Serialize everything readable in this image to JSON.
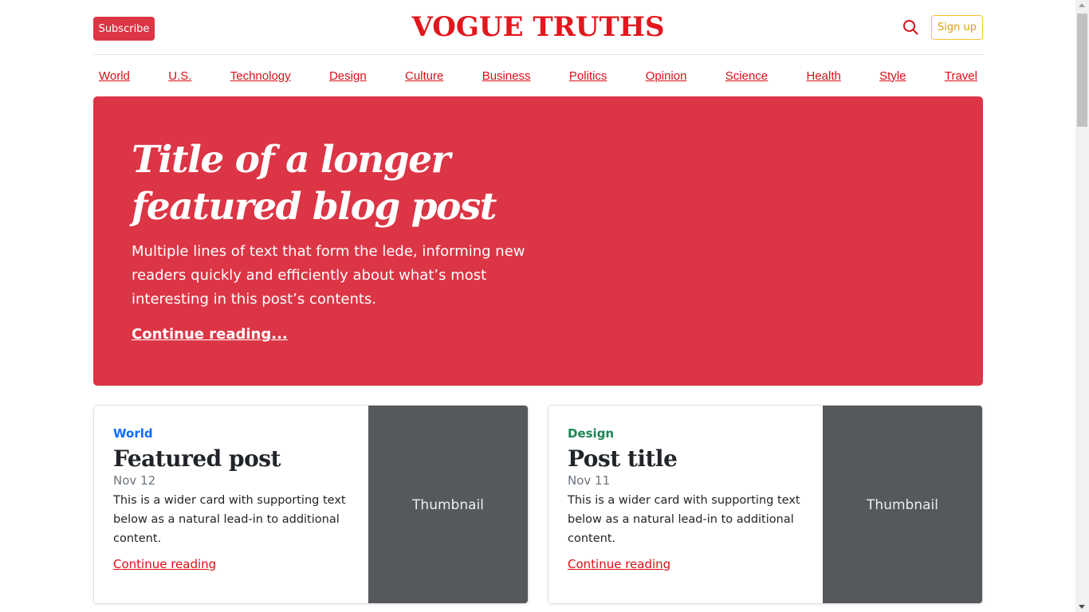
{
  "header": {
    "subscribe_label": "Subscribe",
    "brand": "VOGUE TRUTHS",
    "signup_label": "Sign up",
    "search_icon": "search-icon"
  },
  "nav": {
    "items": [
      "World",
      "U.S.",
      "Technology",
      "Design",
      "Culture",
      "Business",
      "Politics",
      "Opinion",
      "Science",
      "Health",
      "Style",
      "Travel"
    ]
  },
  "hero": {
    "title": "Title of a longer featured blog post",
    "lede": "Multiple lines of text that form the lede, informing new readers quickly and efficiently about what’s most interesting in this post’s contents.",
    "link": "Continue reading..."
  },
  "cards": [
    {
      "category": "World",
      "category_color": "#0d6efd",
      "title": "Featured post",
      "date": "Nov 12",
      "text": "This is a wider card with supporting text below as a natural lead-in to additional content.",
      "link": "Continue reading",
      "thumbnail": "Thumbnail"
    },
    {
      "category": "Design",
      "category_color": "#198754",
      "title": "Post title",
      "date": "Nov 11",
      "text": "This is a wider card with supporting text below as a natural lead-in to additional content.",
      "link": "Continue reading",
      "thumbnail": "Thumbnail"
    }
  ],
  "colors": {
    "brand": "#e2161c",
    "accent": "#dc3545",
    "signup": "#f4c430",
    "thumbnail_bg": "#55595c"
  }
}
